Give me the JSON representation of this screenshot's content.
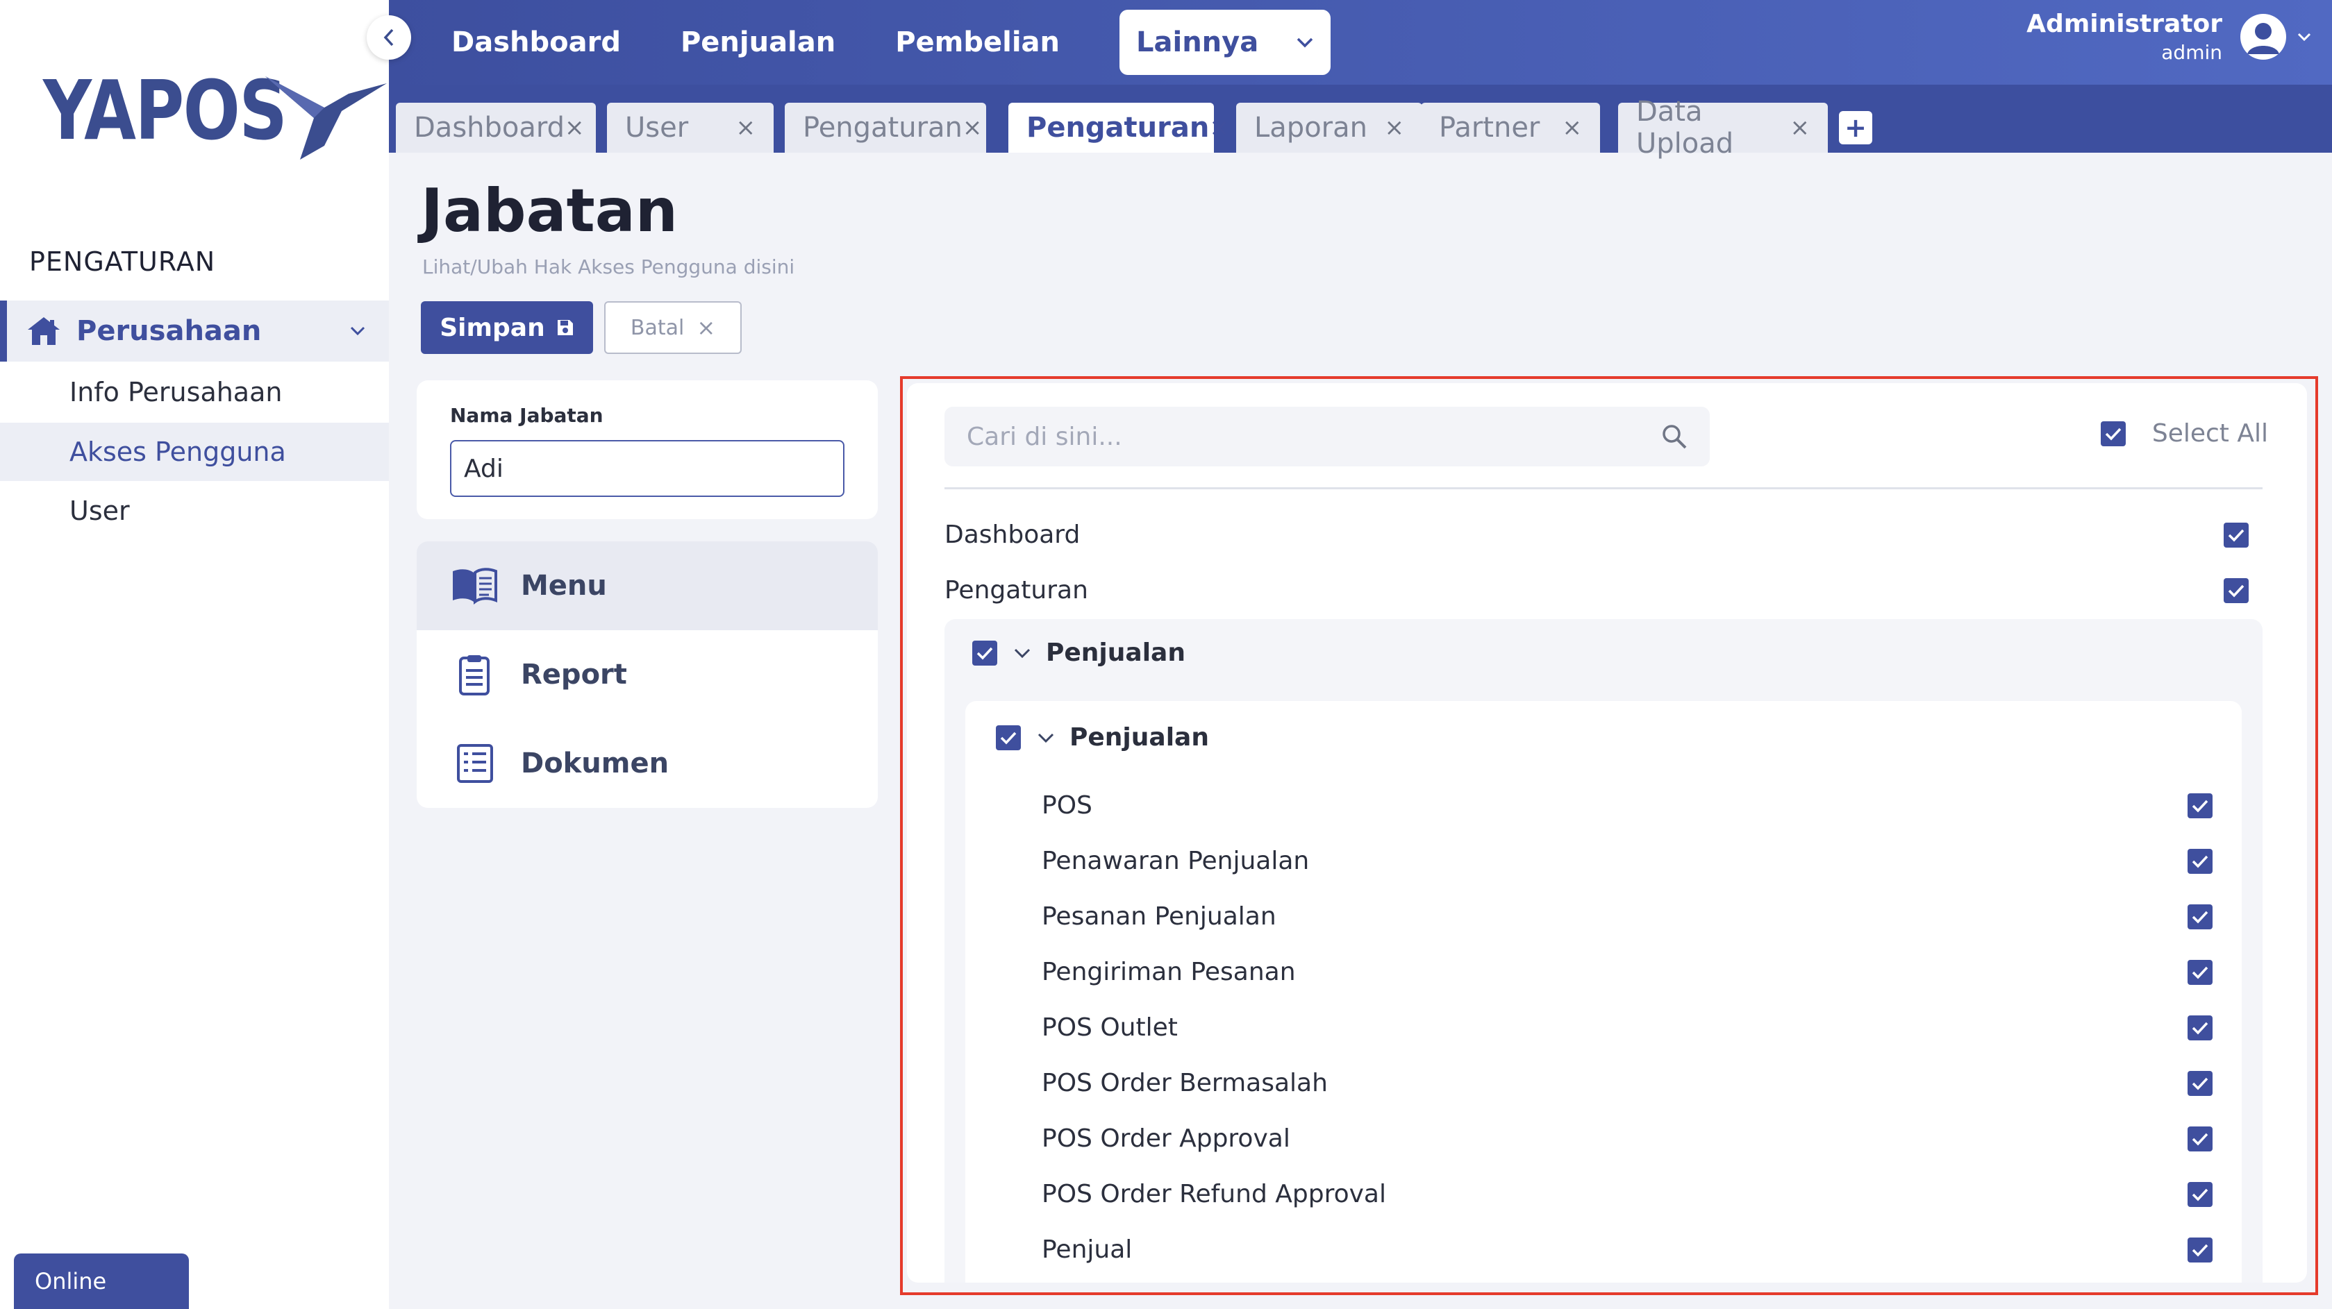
{
  "brand": {
    "logo_text": "YAPOS",
    "accent": "#3f4f9e",
    "highlight": "#e53b2c"
  },
  "sidebar": {
    "section_title": "PENGATURAN",
    "parent": {
      "label": "Perusahaan",
      "icon": "home-icon"
    },
    "items": [
      {
        "label": "Info Perusahaan",
        "active": false
      },
      {
        "label": "Akses Pengguna",
        "active": true
      },
      {
        "label": "User",
        "active": false
      }
    ],
    "status": "Online"
  },
  "topnav": {
    "items": [
      "Dashboard",
      "Penjualan",
      "Pembelian"
    ],
    "dropdown_label": "Lainnya",
    "user_name": "Administrator",
    "user_role": "admin"
  },
  "tabs": [
    {
      "label": "Dashboard",
      "active": false
    },
    {
      "label": "User",
      "active": false
    },
    {
      "label": "Pengaturan",
      "active": false
    },
    {
      "label": "Pengaturan",
      "active": true
    },
    {
      "label": "Laporan",
      "active": false
    },
    {
      "label": "Partner",
      "active": false
    },
    {
      "label": "Data Upload",
      "active": false
    }
  ],
  "tab_add": "+",
  "page": {
    "title": "Jabatan",
    "subtitle": "Lihat/Ubah Hak Akses Pengguna disini",
    "save_label": "Simpan",
    "cancel_label": "Batal"
  },
  "form": {
    "name_label": "Nama Jabatan",
    "name_value": "Adi"
  },
  "menu": [
    {
      "label": "Menu",
      "icon": "book-icon",
      "active": true
    },
    {
      "label": "Report",
      "icon": "clipboard-icon",
      "active": false
    },
    {
      "label": "Dokumen",
      "icon": "list-document-icon",
      "active": false
    }
  ],
  "permissions": {
    "search_placeholder": "Cari di sini...",
    "select_all_label": "Select All",
    "select_all_checked": true,
    "top_items": [
      {
        "label": "Dashboard",
        "checked": true
      },
      {
        "label": "Pengaturan",
        "checked": true
      }
    ],
    "group": {
      "label": "Penjualan",
      "checked": true,
      "subgroup": {
        "label": "Penjualan",
        "checked": true,
        "items": [
          {
            "label": "POS",
            "checked": true
          },
          {
            "label": "Penawaran Penjualan",
            "checked": true
          },
          {
            "label": "Pesanan Penjualan",
            "checked": true
          },
          {
            "label": "Pengiriman Pesanan",
            "checked": true
          },
          {
            "label": "POS Outlet",
            "checked": true
          },
          {
            "label": "POS Order Bermasalah",
            "checked": true
          },
          {
            "label": "POS Order Approval",
            "checked": true
          },
          {
            "label": "POS Order Refund Approval",
            "checked": true
          },
          {
            "label": "Penjual",
            "checked": true
          }
        ]
      }
    }
  }
}
